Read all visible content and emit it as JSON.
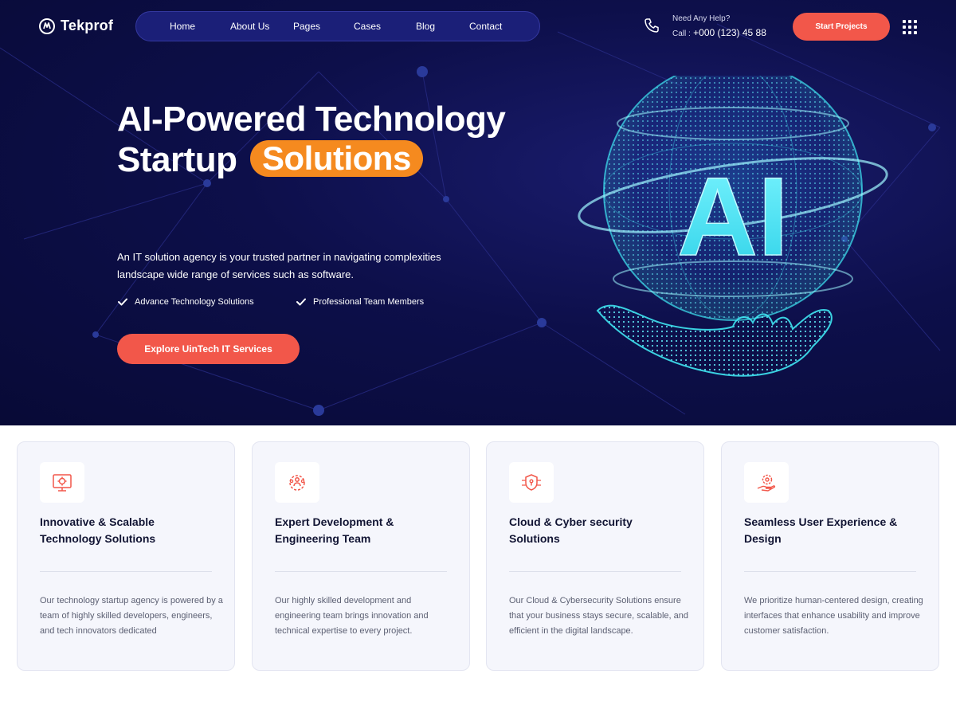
{
  "header": {
    "logo_text": "Tekprof",
    "nav": [
      "Home",
      "About Us",
      "Pages",
      "Cases",
      "Blog",
      "Contact"
    ],
    "help_title": "Need Any Help?",
    "call_label": "Call :",
    "phone": "+000 (123) 45 88",
    "start_button": "Start Projects"
  },
  "hero": {
    "title_line1": "AI-Powered Technology",
    "title_line2": "Startup",
    "title_highlight": "Solutions",
    "description": "An IT solution agency is your trusted partner in navigating complexities landscape wide range of services such as software.",
    "checks": [
      "Advance Technology Solutions",
      "Professional Team Members"
    ],
    "cta": "Explore UinTech IT Services",
    "art_label": "AI"
  },
  "cards": [
    {
      "icon": "monitor-gear-icon",
      "title": "Innovative & Scalable Technology Solutions",
      "text": "Our technology startup agency is powered by a team of highly skilled developers, engineers, and tech innovators dedicated"
    },
    {
      "icon": "team-gear-icon",
      "title": "Expert Development & Engineering Team",
      "text": "Our highly skilled development and engineering team brings innovation and technical expertise to every project."
    },
    {
      "icon": "shield-network-icon",
      "title": "Cloud & Cyber security Solutions",
      "text": "Our Cloud & Cybersecurity Solutions ensure that your business stays secure, scalable, and efficient in the digital landscape."
    },
    {
      "icon": "hand-gear-icon",
      "title": "Seamless User Experience & Design",
      "text": "We prioritize human-centered design, creating interfaces that enhance usability and improve customer satisfaction."
    }
  ],
  "colors": {
    "hero_bg": "#0d0f4a",
    "accent_red": "#f2574a",
    "accent_orange": "#f58a1f",
    "nav_bg": "#1b1f78",
    "glow_cyan": "#3fe6f2",
    "card_bg": "#f5f6fc"
  }
}
